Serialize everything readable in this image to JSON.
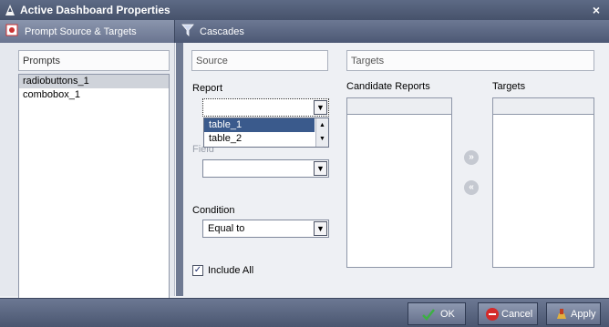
{
  "window": {
    "title": "Active Dashboard Properties",
    "close_glyph": "×"
  },
  "tabs": [
    {
      "label": "Prompt Source & Targets",
      "icon": "prompt-source-icon"
    },
    {
      "label": "Cascades",
      "icon": "cascades-icon"
    }
  ],
  "prompts": {
    "header": "Prompts",
    "items": [
      "radiobuttons_1",
      "combobox_1"
    ],
    "selected": "radiobuttons_1"
  },
  "source": {
    "header": "Source",
    "report_label": "Report",
    "report_value": "",
    "report_options": [
      "table_1",
      "table_2"
    ],
    "report_highlighted": "table_1",
    "field_label": "Field",
    "field_value": "",
    "condition_label": "Condition",
    "condition_value": "Equal to",
    "include_all_label": "Include All",
    "include_all_checked": true
  },
  "targets": {
    "header": "Targets",
    "candidate_label": "Candidate Reports",
    "targets_label": "Targets",
    "add_glyph": "»",
    "remove_glyph": "«"
  },
  "footer": {
    "ok_label": "OK",
    "cancel_label": "Cancel",
    "apply_label": "Apply"
  },
  "colors": {
    "titlebar": "#46526b",
    "accent_selection": "#3a5a8c",
    "ok_check": "#3cb043",
    "cancel_red": "#d42a2a"
  }
}
